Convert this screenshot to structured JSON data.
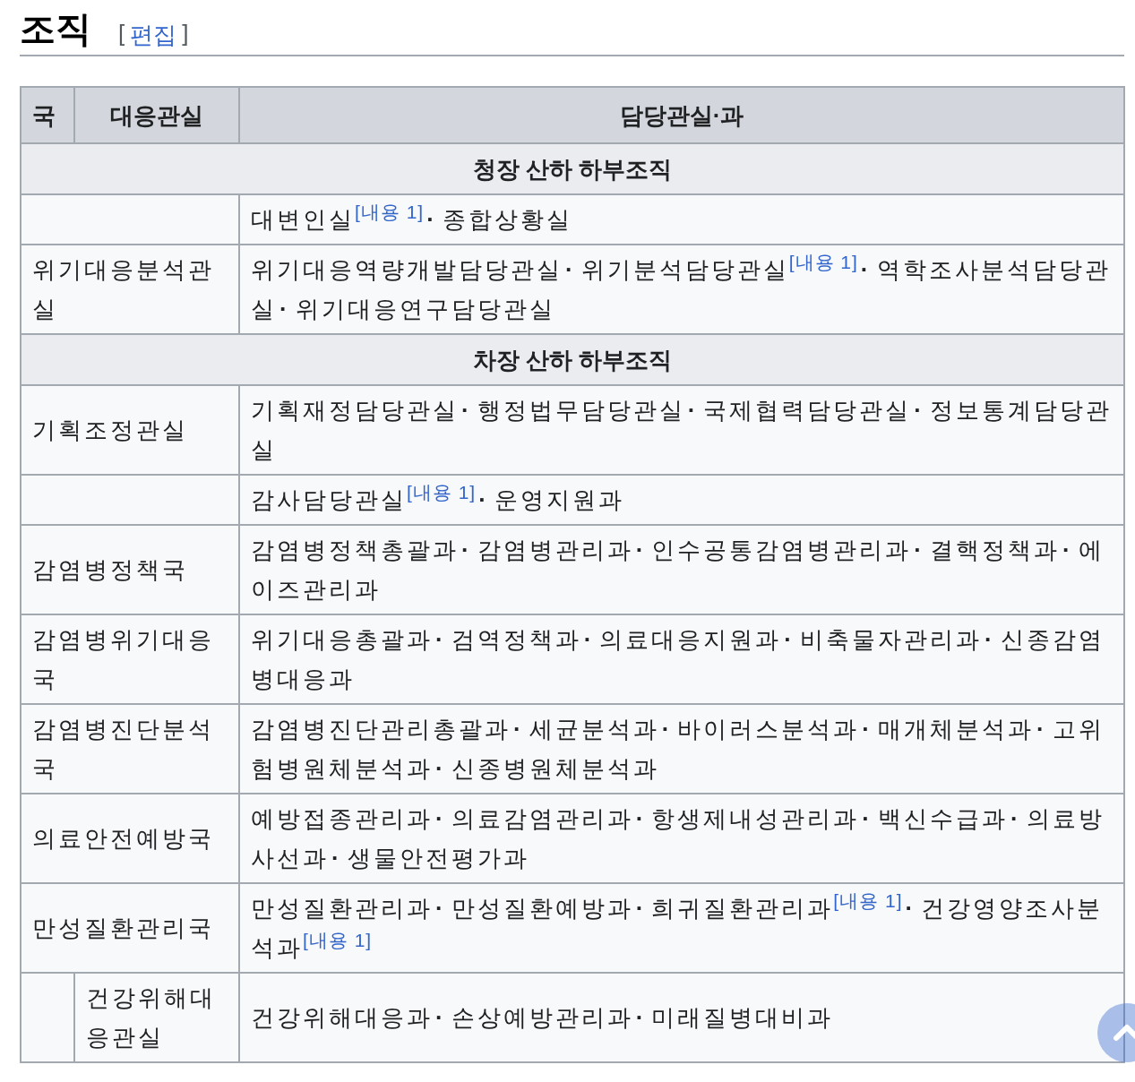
{
  "heading": {
    "title": "조직",
    "edit_link": "편집",
    "bracket_open": "[",
    "bracket_close": "]"
  },
  "separator": "·",
  "table": {
    "columns": [
      "국",
      "대응관실",
      "담당관실·과"
    ],
    "rows": [
      {
        "kind": "section",
        "label": "청장 산하 하부조직"
      },
      {
        "kind": "unit",
        "offices": [
          {
            "name": "대변인실",
            "note": "[내용 1]"
          },
          {
            "name": "종합상황실"
          }
        ]
      },
      {
        "kind": "unit",
        "unit": "위기대응분석관실",
        "offices": [
          {
            "name": "위기대응역량개발담당관실"
          },
          {
            "name": "위기분석담당관실",
            "note": "[내용 1]"
          },
          {
            "name": "역학조사분석담당관실"
          },
          {
            "name": "위기대응연구담당관실"
          }
        ]
      },
      {
        "kind": "section",
        "label": "차장 산하 하부조직"
      },
      {
        "kind": "unit",
        "unit": "기획조정관실",
        "offices": [
          {
            "name": "기획재정담당관실"
          },
          {
            "name": "행정법무담당관실"
          },
          {
            "name": "국제협력담당관실"
          },
          {
            "name": "정보통계담당관실"
          }
        ]
      },
      {
        "kind": "unit",
        "offices": [
          {
            "name": "감사담당관실",
            "note": "[내용 1]"
          },
          {
            "name": "운영지원과"
          }
        ]
      },
      {
        "kind": "unit",
        "unit": "감염병정책국",
        "offices": [
          {
            "name": "감염병정책총괄과"
          },
          {
            "name": "감염병관리과"
          },
          {
            "name": "인수공통감염병관리과"
          },
          {
            "name": "결핵정책과"
          },
          {
            "name": "에이즈관리과"
          }
        ]
      },
      {
        "kind": "unit",
        "unit": "감염병위기대응국",
        "offices": [
          {
            "name": "위기대응총괄과"
          },
          {
            "name": "검역정책과"
          },
          {
            "name": "의료대응지원과"
          },
          {
            "name": "비축물자관리과"
          },
          {
            "name": "신종감염병대응과"
          }
        ]
      },
      {
        "kind": "unit",
        "unit": "감염병진단분석국",
        "offices": [
          {
            "name": "감염병진단관리총괄과"
          },
          {
            "name": "세균분석과"
          },
          {
            "name": "바이러스분석과"
          },
          {
            "name": "매개체분석과"
          },
          {
            "name": "고위험병원체분석과"
          },
          {
            "name": "신종병원체분석과"
          }
        ]
      },
      {
        "kind": "unit",
        "unit": "의료안전예방국",
        "offices": [
          {
            "name": "예방접종관리과"
          },
          {
            "name": "의료감염관리과"
          },
          {
            "name": "항생제내성관리과"
          },
          {
            "name": "백신수급과"
          },
          {
            "name": "의료방사선과"
          },
          {
            "name": "생물안전평가과"
          }
        ]
      },
      {
        "kind": "unit",
        "unit": "만성질환관리국",
        "offices": [
          {
            "name": "만성질환관리과"
          },
          {
            "name": "만성질환예방과"
          },
          {
            "name": "희귀질환관리과",
            "note": "[내용 1]"
          },
          {
            "name": "건강영양조사분석과",
            "note": "[내용 1]"
          }
        ],
        "children": [
          {
            "unit": "건강위해대응관실",
            "offices": [
              {
                "name": "건강위해대응과"
              },
              {
                "name": "손상예방관리과"
              },
              {
                "name": "미래질병대비과"
              }
            ]
          }
        ]
      }
    ]
  }
}
